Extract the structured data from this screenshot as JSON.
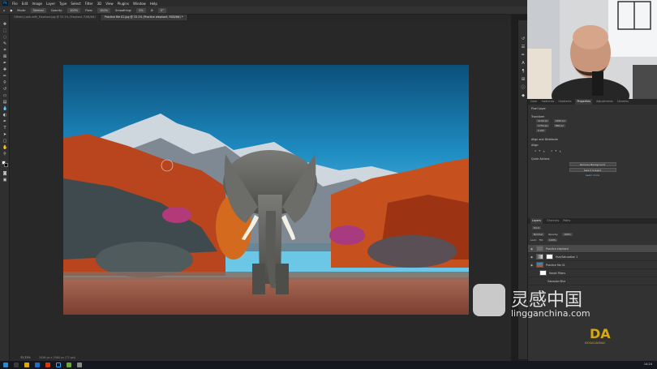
{
  "app": {
    "menu": [
      "File",
      "Edit",
      "Image",
      "Layer",
      "Type",
      "Select",
      "Filter",
      "3D",
      "View",
      "Plugins",
      "Window",
      "Help"
    ]
  },
  "options": {
    "mode_label": "Mode:",
    "mode_value": "Normal",
    "opacity_label": "Opacity:",
    "opacity_value": "100%",
    "flow_label": "Flow:",
    "flow_value": "100%",
    "smoothing_label": "Smoothing:",
    "smoothing_value": "0%",
    "angle_value": "0°"
  },
  "tabs": [
    {
      "label": "Oilfield_Look-with_Elephant.jpg @ 33.1% (Elephant, RGB/8#)"
    },
    {
      "label": "Practice file 01.jpg @ 33.1% (Practice elephant, RGB/8#) *"
    }
  ],
  "status": {
    "zoom": "33.33%",
    "doc": "3456 px x 2060 px (72 ppi)"
  },
  "panels": {
    "top_tabs": [
      "Color",
      "Swatches",
      "Gradients",
      "Properties",
      "Adjustments",
      "Libraries"
    ],
    "active_top_tab": "Properties",
    "pixel_layer_label": "Pixel Layer",
    "transform_label": "Transform",
    "w_value": "1130 px",
    "h_value": "1482 px",
    "x_value": "1754 px",
    "y_value": "858 px",
    "angle": "0.00°",
    "align_label": "Align and Distribute",
    "align_sub": "Align:",
    "quick_actions_label": "Quick Actions",
    "remove_bg": "Remove Background",
    "select_subject": "Select Subject",
    "learn_more": "Learn more",
    "layer_tabs": [
      "Layers",
      "Channels",
      "Paths"
    ],
    "kind_label": "Kind",
    "blend_mode": "Normal",
    "opacity_label": "Opacity:",
    "opacity": "100%",
    "lock_label": "Lock:",
    "fill_label": "Fill:",
    "fill": "100%",
    "layers": [
      {
        "name": "Practice elephant"
      },
      {
        "name": "Hue/Saturation 1"
      },
      {
        "name": "Practice file 01"
      },
      {
        "name": "Smart Filters"
      },
      {
        "name": "Gaussian Blur"
      }
    ]
  },
  "watermark": {
    "brand": "灵感中国",
    "url": "lingganchina.com",
    "corner_logo": "DA",
    "corner_sub": "DOGACAKMAC"
  },
  "taskbar": {
    "time": "14:24"
  },
  "colors": {
    "accent": "#31a8ff",
    "panel_bg": "#323232",
    "canvas_bg": "#282828",
    "selected_row": "#4a4a4a"
  }
}
